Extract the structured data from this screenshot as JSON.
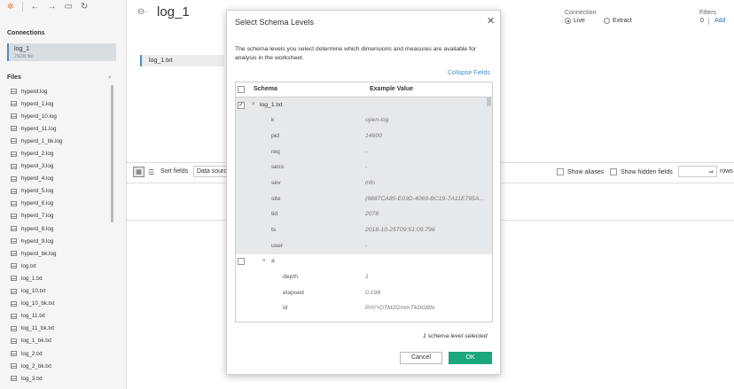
{
  "toolbar": {
    "logo": "✲",
    "back": "←",
    "forward": "→",
    "save": "▭",
    "refresh": "↻"
  },
  "connections": {
    "heading": "Connections",
    "item_name": "log_1",
    "item_type": "JSON file"
  },
  "files": {
    "heading": "Files",
    "search_icon": "⌕",
    "items": [
      "hyperd.log",
      "hyperd_1.log",
      "hyperd_10.log",
      "hyperd_11.log",
      "hyperd_1_bk.log",
      "hyperd_2.log",
      "hyperd_3.log",
      "hyperd_4.log",
      "hyperd_5.log",
      "hyperd_6.log",
      "hyperd_7.log",
      "hyperd_8.log",
      "hyperd_9.log",
      "hyperd_bk.log",
      "log.txt",
      "log_1.txt",
      "log_10.txt",
      "log_10_bk.txt",
      "log_11.txt",
      "log_11_bk.txt",
      "log_1_bk.txt",
      "log_2.txt",
      "log_2_bk.txt",
      "log_3.txt"
    ]
  },
  "main": {
    "datasource_icon": "⊖·",
    "datasource_title": "log_1",
    "canvas_table": "log_1.txt",
    "connection_label": "Connection",
    "live_label": "Live",
    "extract_label": "Extract",
    "filters_label": "Filters",
    "filters_count": "0",
    "filters_add": "Add"
  },
  "grid": {
    "sort_label": "Sort fields",
    "sort_value": "Data source order",
    "show_aliases": "Show aliases",
    "show_hidden": "Show hidden fields",
    "rows_arrow": "⇒",
    "rows_label": "rows"
  },
  "dialog": {
    "title": "Select Schema Levels",
    "close": "✕",
    "description": "The schema levels you select determine which dimensions and measures are available for analysis in the worksheet.",
    "collapse_link": "Collapse Fields",
    "col_schema": "Schema",
    "col_example": "Example Value",
    "rows": [
      {
        "level": 0,
        "name": "log_1.txt",
        "value": "",
        "checkbox": true,
        "checked": true,
        "chevron": "˅",
        "selected": true
      },
      {
        "level": 1,
        "name": "k",
        "value": "open-log",
        "selected": true
      },
      {
        "level": 1,
        "name": "pid",
        "value": "14600",
        "selected": true
      },
      {
        "level": 1,
        "name": "req",
        "value": "-",
        "selected": true
      },
      {
        "level": 1,
        "name": "sess",
        "value": "-",
        "selected": true
      },
      {
        "level": 1,
        "name": "sev",
        "value": "info",
        "selected": true
      },
      {
        "level": 1,
        "name": "site",
        "value": "{9887CA85-E03D-4069-BC19-7A11E795A...",
        "selected": true
      },
      {
        "level": 1,
        "name": "tid",
        "value": "2078",
        "selected": true
      },
      {
        "level": 1,
        "name": "ts",
        "value": "2018-10-25T09:51:09.796",
        "selected": true
      },
      {
        "level": 1,
        "name": "user",
        "value": "-",
        "selected": true
      },
      {
        "level": 1,
        "name": "a",
        "value": "",
        "checkbox": true,
        "checked": false,
        "chevron": "˅",
        "selected": false
      },
      {
        "level": 2,
        "name": "depth",
        "value": "1",
        "selected": false
      },
      {
        "level": 2,
        "name": "elapsed",
        "value": "0.199",
        "selected": false
      },
      {
        "level": 2,
        "name": "id",
        "value": "P////+DTkt2l2mmTkDGBfx",
        "selected": false
      }
    ],
    "status": "1 schema level selected",
    "cancel": "Cancel",
    "ok": "OK"
  }
}
